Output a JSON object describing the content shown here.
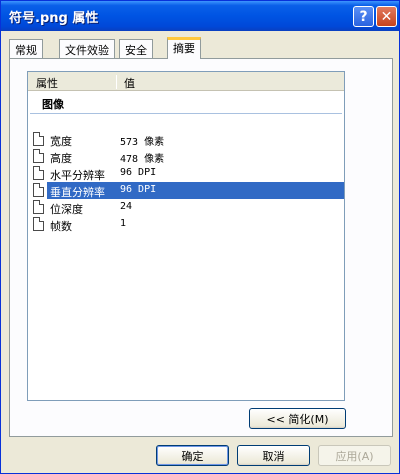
{
  "window": {
    "title": "符号.png 属性",
    "help_label": "?",
    "close_label": "✕"
  },
  "tabs": [
    {
      "label": "常规"
    },
    {
      "label": "文件效验"
    },
    {
      "label": "安全"
    },
    {
      "label": "摘要",
      "active": true
    }
  ],
  "listview": {
    "headers": {
      "property": "属性",
      "value": "值"
    },
    "group": "图像",
    "rows": [
      {
        "name": "宽度",
        "value": "573 像素"
      },
      {
        "name": "高度",
        "value": "478 像素"
      },
      {
        "name": "水平分辨率",
        "value": "96 DPI"
      },
      {
        "name": "垂直分辨率",
        "value": "96 DPI",
        "selected": true
      },
      {
        "name": "位深度",
        "value": "24"
      },
      {
        "name": "帧数",
        "value": "1"
      }
    ]
  },
  "buttons": {
    "simplify": "<< 简化(M)",
    "ok": "确定",
    "cancel": "取消",
    "apply": "应用(A)"
  },
  "colors": {
    "titlebar": "#0054e3",
    "selection": "#316ac5",
    "active_tab_accent": "#ffc83c"
  },
  "icons": {
    "row_icon": "document-icon"
  }
}
